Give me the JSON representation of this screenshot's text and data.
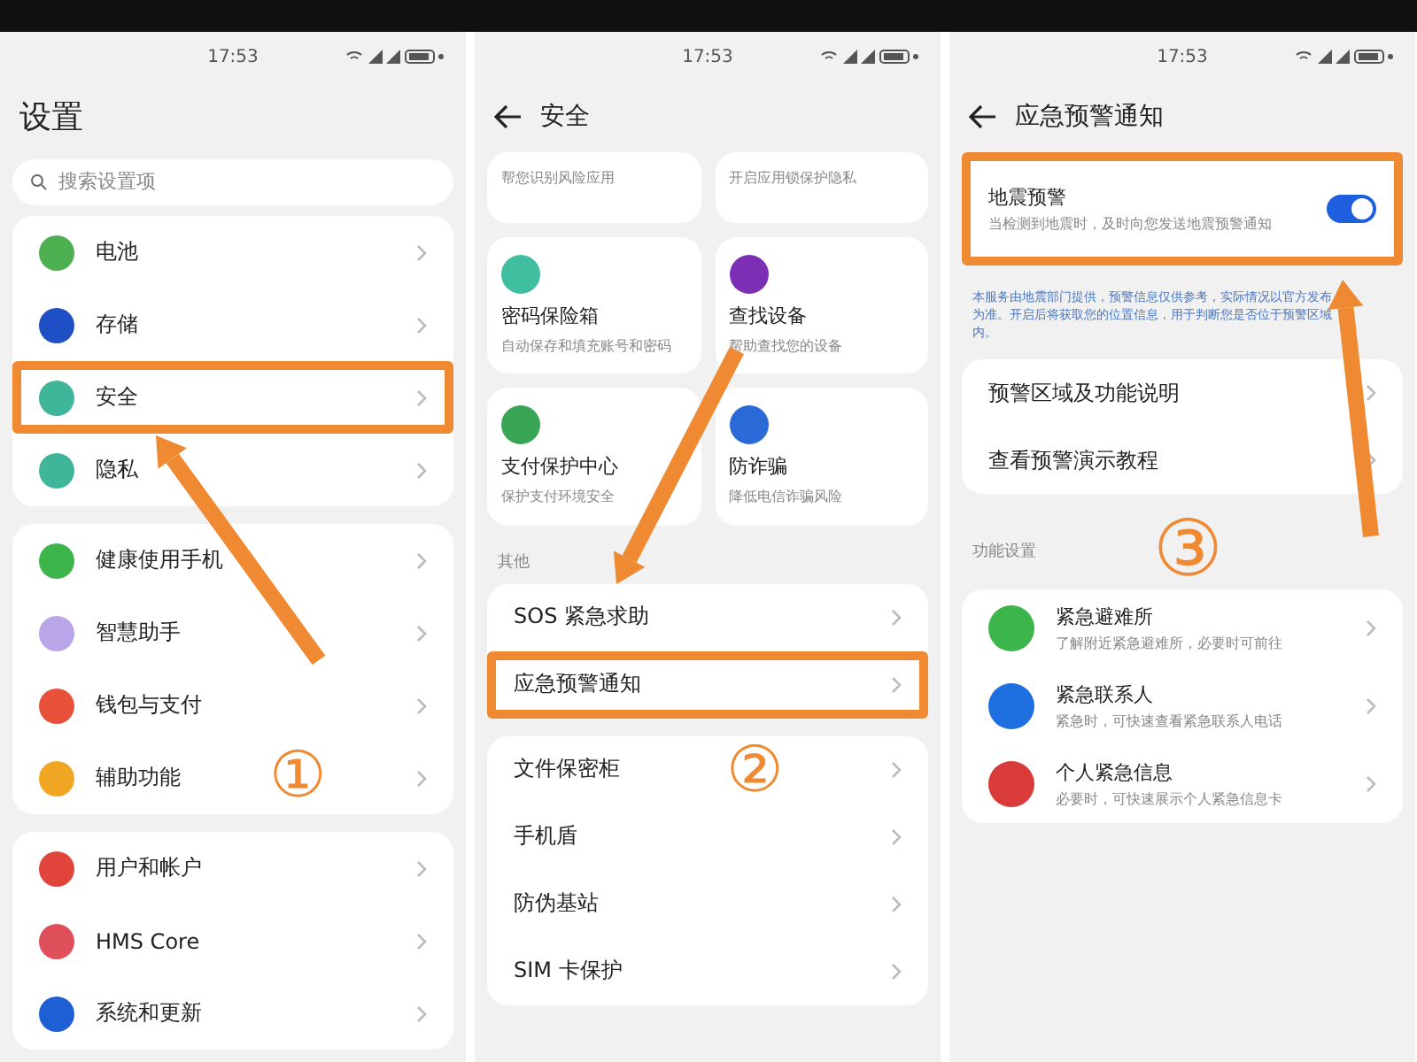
{
  "panels": [
    {
      "kind": "settings",
      "time": "17:53",
      "title": "设置",
      "back": false,
      "search": {
        "placeholder": "搜索设置项"
      },
      "groups": [
        {
          "items": [
            {
              "label": "电池",
              "color": "#4caf50",
              "highlighted": false
            },
            {
              "label": "存储",
              "color": "#1e4fc4",
              "highlighted": false
            },
            {
              "label": "安全",
              "color": "#3fb59a",
              "highlighted": true
            },
            {
              "label": "隐私",
              "color": "#3fb59a",
              "highlighted": false
            }
          ]
        },
        {
          "items": [
            {
              "label": "健康使用手机",
              "color": "#3cb54a",
              "highlighted": false
            },
            {
              "label": "智慧助手",
              "color": "#b9a6e8",
              "highlighted": false
            },
            {
              "label": "钱包与支付",
              "color": "#e8503a",
              "highlighted": false
            },
            {
              "label": "辅助功能",
              "color": "#f0a623",
              "highlighted": false
            }
          ]
        },
        {
          "items": [
            {
              "label": "用户和帐户",
              "color": "#e0443a",
              "highlighted": false
            },
            {
              "label": "HMS Core",
              "color": "#e0505a",
              "highlighted": false
            },
            {
              "label": "系统和更新",
              "color": "#1e5fd6",
              "highlighted": false
            }
          ]
        }
      ],
      "step": {
        "label": "①"
      }
    },
    {
      "kind": "security",
      "time": "17:53",
      "title": "安全",
      "back": true,
      "cards": [
        {
          "desc": "帮您识别风险应用"
        },
        {
          "desc": "开启应用锁保护隐私"
        },
        {
          "title": "密码保险箱",
          "desc": "自动保存和填充账号和密码",
          "color": "#3fbfa0"
        },
        {
          "title": "查找设备",
          "desc": "帮助查找您的设备",
          "color": "#7b2fb5"
        },
        {
          "title": "支付保护中心",
          "desc": "保护支付环境安全",
          "color": "#3aa655"
        },
        {
          "title": "防诈骗",
          "desc": "降低电信诈骗风险",
          "color": "#2a6ad6"
        }
      ],
      "section": "其他",
      "groups": [
        {
          "items": [
            {
              "label": "SOS 紧急求助",
              "highlighted": false
            },
            {
              "label": "应急预警通知",
              "highlighted": true
            }
          ]
        },
        {
          "items": [
            {
              "label": "文件保密柜",
              "highlighted": false
            },
            {
              "label": "手机盾",
              "highlighted": false
            },
            {
              "label": "防伪基站",
              "highlighted": false
            },
            {
              "label": "SIM 卡保护",
              "highlighted": false
            }
          ]
        }
      ],
      "step": {
        "label": "②"
      }
    },
    {
      "kind": "alert",
      "time": "17:53",
      "title": "应急预警通知",
      "back": true,
      "toggle": {
        "label": "地震预警",
        "desc": "当检测到地震时，及时向您发送地震预警通知",
        "on": true,
        "highlighted": true
      },
      "note": "本服务由地震部门提供，预警信息仅供参考，实际情况以官方发布为准。开启后将获取您的位置信息，用于判断您是否位于预警区域内。",
      "groups": [
        {
          "items": [
            {
              "label": "预警区域及功能说明",
              "highlighted": false
            },
            {
              "label": "查看预警演示教程",
              "highlighted": false
            }
          ]
        }
      ],
      "section": "功能设置",
      "rows": [
        {
          "title": "紧急避难所",
          "desc": "了解附近紧急避难所，必要时可前往",
          "color": "#3cb54a"
        },
        {
          "title": "紧急联系人",
          "desc": "紧急时，可快速查看紧急联系人电话",
          "color": "#1e6fe0"
        },
        {
          "title": "个人紧急信息",
          "desc": "必要时，可快速展示个人紧急信息卡",
          "color": "#d93a3a"
        }
      ],
      "step": {
        "label": "③"
      }
    }
  ]
}
